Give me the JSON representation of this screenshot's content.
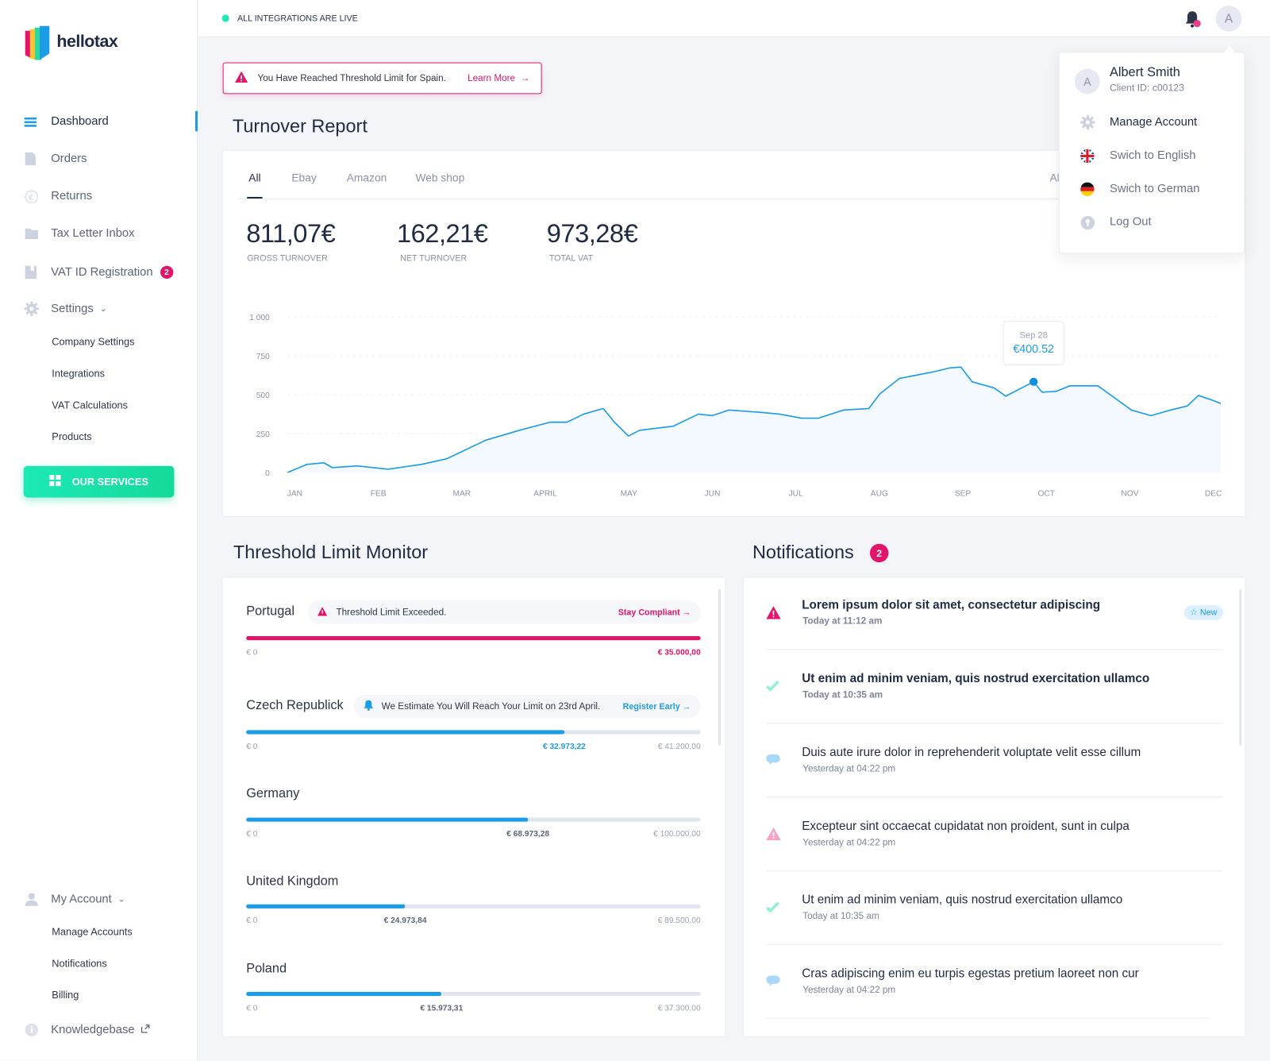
{
  "brand": {
    "name": "hellotax"
  },
  "colors": {
    "accent": "#1a9ce6",
    "alert": "#e2156b",
    "success": "#1de9b6",
    "text": "#1f2a44"
  },
  "sidebar": {
    "items": [
      {
        "label": "Dashboard",
        "icon": "menu-icon",
        "active": true
      },
      {
        "label": "Orders",
        "icon": "document-icon"
      },
      {
        "label": "Returns",
        "icon": "euro-return-icon"
      },
      {
        "label": "Tax Letter Inbox",
        "icon": "folder-icon"
      },
      {
        "label": "VAT ID Registration",
        "icon": "bookmark-icon",
        "badge": "2"
      },
      {
        "label": "Settings",
        "icon": "gear-icon"
      }
    ],
    "settings_sub": [
      "Company Settings",
      "Integrations",
      "VAT Calculations",
      "Products"
    ],
    "services_button": "OUR SERVICES",
    "account": {
      "label": "My Account",
      "sub": [
        "Manage Accounts",
        "Notifications",
        "Billing"
      ]
    },
    "knowledgebase": "Knowledgebase"
  },
  "topbar": {
    "status": "ALL INTEGRATIONS ARE LIVE",
    "avatar": "A"
  },
  "alert": {
    "text": "You Have Reached Threshold Limit for Spain.",
    "link": "Learn More"
  },
  "turnover": {
    "title": "Turnover Report",
    "tabs": [
      "All",
      "Ebay",
      "Amazon",
      "Web shop"
    ],
    "active_tab": "All",
    "range_select": "All",
    "stats": [
      {
        "value": "811,07€",
        "label": "GROSS TURNOVER"
      },
      {
        "value": "162,21€",
        "label": "NET TURNOVER"
      },
      {
        "value": "973,28€",
        "label": "TOTAL VAT"
      }
    ]
  },
  "chart_data": {
    "type": "area",
    "ylim": [
      0,
      1000
    ],
    "y_ticks": [
      "0",
      "250",
      "500",
      "750",
      "1 000"
    ],
    "y_tick_values": [
      0,
      250,
      500,
      750,
      1000
    ],
    "x_ticks": [
      "JAN",
      "FEB",
      "MAR",
      "APRIL",
      "MAY",
      "JUN",
      "JUL",
      "AUG",
      "SEP",
      "OCT",
      "NOV",
      "DEC"
    ],
    "grid": true,
    "color": "#1a9ce6",
    "points": [
      [
        "01-01",
        0
      ],
      [
        "01-08",
        52
      ],
      [
        "01-14",
        62
      ],
      [
        "01-17",
        31
      ],
      [
        "01-26",
        42
      ],
      [
        "02-07",
        21
      ],
      [
        "02-19",
        52
      ],
      [
        "02-28",
        88
      ],
      [
        "03-12",
        208
      ],
      [
        "03-24",
        271
      ],
      [
        "04-05",
        323
      ],
      [
        "04-11",
        323
      ],
      [
        "04-17",
        375
      ],
      [
        "04-24",
        411
      ],
      [
        "04-28",
        323
      ],
      [
        "05-03",
        234
      ],
      [
        "05-07",
        271
      ],
      [
        "05-19",
        297
      ],
      [
        "05-28",
        375
      ],
      [
        "06-03",
        365
      ],
      [
        "06-09",
        401
      ],
      [
        "06-21",
        385
      ],
      [
        "06-27",
        375
      ],
      [
        "07-05",
        349
      ],
      [
        "07-11",
        349
      ],
      [
        "07-20",
        401
      ],
      [
        "07-29",
        411
      ],
      [
        "08-03",
        505
      ],
      [
        "08-10",
        604
      ],
      [
        "08-22",
        646
      ],
      [
        "08-28",
        672
      ],
      [
        "09-02",
        677
      ],
      [
        "09-06",
        583
      ],
      [
        "09-14",
        542
      ],
      [
        "09-18",
        490
      ],
      [
        "09-28",
        583
      ],
      [
        "10-01",
        516
      ],
      [
        "10-06",
        521
      ],
      [
        "10-11",
        557
      ],
      [
        "10-21",
        557
      ],
      [
        "10-27",
        479
      ],
      [
        "11-03",
        401
      ],
      [
        "11-10",
        365
      ],
      [
        "11-17",
        401
      ],
      [
        "11-23",
        427
      ],
      [
        "11-27",
        495
      ],
      [
        "12-02",
        464
      ],
      [
        "12-05",
        443
      ]
    ],
    "tooltip": {
      "date": "Sep 28",
      "value": "€400.52",
      "at": "09-28"
    }
  },
  "threshold": {
    "title": "Threshold Limit Monitor",
    "rows": [
      {
        "country": "Portugal",
        "notice": "Threshold Limit Exceeded.",
        "notice_icon": "warning-icon",
        "link": "Stay Compliant",
        "start": "€ 0",
        "current": "",
        "limit": "€ 35.000,00",
        "progress": 1.0,
        "status": "exceeded"
      },
      {
        "country": "Czech Republick",
        "notice": "We Estimate You Will Reach Your Limit on 23rd April.",
        "notice_icon": "bell-icon",
        "link": "Register Early",
        "start": "€ 0",
        "current": "€ 32.973,22",
        "limit": "€ 41.200,00",
        "progress": 0.7,
        "status": "warning"
      },
      {
        "country": "Germany",
        "start": "€ 0",
        "current": "€ 68.973,28",
        "limit": "€ 100.000,00",
        "progress": 0.62
      },
      {
        "country": "United Kingdom",
        "start": "€ 0",
        "current": "€ 24.973,84",
        "limit": "€ 89.500,00",
        "progress": 0.35
      },
      {
        "country": "Poland",
        "start": "€ 0",
        "current": "€ 15.973,31",
        "limit": "€ 37.300,00",
        "progress": 0.43
      }
    ]
  },
  "notifications": {
    "title": "Notifications",
    "count": "2",
    "new_badge": "New",
    "items": [
      {
        "title": "Lorem ipsum dolor sit amet, consectetur adipiscing",
        "time": "Today at 11:12 am",
        "icon": "warning-icon",
        "unread": true,
        "new": true
      },
      {
        "title": "Ut enim ad minim veniam, quis nostrud exercitation ullamco",
        "time": "Today at 10:35 am",
        "icon": "check-icon",
        "unread": true
      },
      {
        "title": "Duis aute irure dolor in reprehenderit voluptate velit esse cillum",
        "time": "Yesterday at 04:22 pm",
        "icon": "chat-icon"
      },
      {
        "title": "Excepteur sint occaecat cupidatat non proident, sunt in culpa",
        "time": "Yesterday at 04:22 pm",
        "icon": "warning-icon"
      },
      {
        "title": "Ut enim ad minim veniam, quis nostrud exercitation ullamco",
        "time": "Today at 10:35 am",
        "icon": "check-icon"
      },
      {
        "title": "Cras adipiscing enim eu turpis egestas pretium laoreet non cur",
        "time": "Yesterday at 04:22 pm",
        "icon": "chat-icon"
      }
    ]
  },
  "user_menu": {
    "name": "Albert Smith",
    "client_id": "Client ID: c00123",
    "avatar": "A",
    "items": [
      {
        "label": "Manage Account",
        "icon": "gear-icon"
      },
      {
        "label": "Swich to English",
        "icon": "uk-flag-icon"
      },
      {
        "label": "Swich to German",
        "icon": "german-flag-icon"
      },
      {
        "label": "Log Out",
        "icon": "logout-icon"
      }
    ]
  }
}
